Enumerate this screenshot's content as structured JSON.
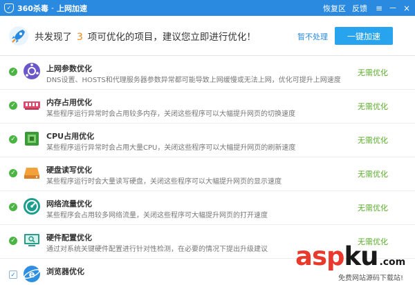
{
  "titlebar": {
    "app_name": "360杀毒",
    "separator": "-",
    "page_name": "上网加速",
    "restore_area": "恢复区",
    "feedback": "反馈",
    "menu_glyph": "≡",
    "minimize_glyph": "－",
    "close_glyph": "×"
  },
  "header": {
    "summary_prefix": "共发现了",
    "count": "3",
    "summary_suffix": "项可优化的项目，建议您立即进行优化！",
    "skip_label": "暂不处理",
    "optimize_label": "一键加速"
  },
  "items": [
    {
      "title": "上网参数优化",
      "desc": "DNS设置、HOSTS和代理服务器参数异常都可能导致上网缓慢或无法上网，优化可提升上网速度",
      "status": "无需优化",
      "icon": "network-params-icon"
    },
    {
      "title": "内存占用优化",
      "desc": "某些程序运行异常时会占用较多内存，关闭这些程序可以大幅提升网页的切换速度",
      "status": "无需优化",
      "icon": "memory-icon"
    },
    {
      "title": "CPU占用优化",
      "desc": "某些程序运行异常时会占用大量CPU，关闭这些程序可以大幅提升网页的刷新速度",
      "status": "无需优化",
      "icon": "cpu-icon"
    },
    {
      "title": "硬盘读写优化",
      "desc": "某些程序运行时会大量读写硬盘，关闭这些程序可以大幅提升网页的显示速度",
      "status": "无需优化",
      "icon": "hard-disk-icon"
    },
    {
      "title": "网络流量优化",
      "desc": "某些程序会占用较多网络流量，关闭这些程序可大幅提升网页的打开速度",
      "status": "无需优化",
      "icon": "network-traffic-icon"
    },
    {
      "title": "硬件配置优化",
      "desc": "通过对系统关键硬件配置进行针对性检测，在必要的情况下提出升级建议",
      "status": "无需优化",
      "icon": "hardware-config-icon"
    },
    {
      "title": "浏览器优化",
      "desc": "",
      "status": "",
      "icon": "browser-icon"
    }
  ],
  "watermark": {
    "brand_a": "asp",
    "brand_b": "ku",
    "brand_c": ".com",
    "tagline": "免费网站源码下载站!"
  },
  "colors": {
    "titlebar": "#2a8ae0",
    "accent_count": "#f08a1c",
    "button": "#28a3ee",
    "status_ok": "#5aab2a",
    "check": "#4bb543"
  }
}
